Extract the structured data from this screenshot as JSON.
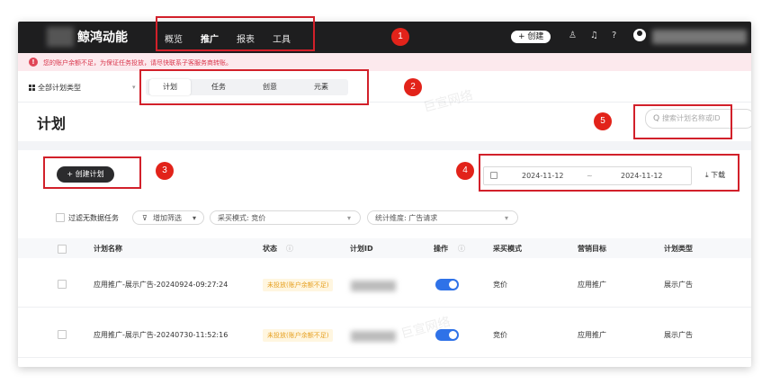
{
  "topbar": {
    "brand": "鲸鸿动能",
    "nav": [
      "概览",
      "推广",
      "报表",
      "工具"
    ],
    "active_nav": "推广",
    "create_label": "+ 创建",
    "icons": [
      "bulb-icon",
      "bell-icon",
      "help-icon",
      "user-icon"
    ]
  },
  "alert": {
    "icon": "!",
    "text": "您的账户余额不足，为保证任务投放，请尽快联系子客服务商转账。"
  },
  "plan_type_selector": "全部计划类型",
  "tabs": [
    "计划",
    "任务",
    "创意",
    "元素"
  ],
  "active_tab": "计划",
  "page_title": "计划",
  "search": {
    "placeholder": "搜索计划名称或ID",
    "icon": "Q"
  },
  "create_plan_label": "+ 创建计划",
  "date_range": {
    "start": "2024-11-12",
    "separator": "~",
    "end": "2024-11-12"
  },
  "download_label": "下载",
  "filters": {
    "filter_no_data": "过滤无数据任务",
    "add_filter": "增加筛选",
    "bidding": "采买模式: 竞价",
    "stat_dimension": "统计维度: 广告请求"
  },
  "table": {
    "headers": [
      "计划名称",
      "状态",
      "计划ID",
      "操作",
      "采买模式",
      "营销目标",
      "计划类型"
    ],
    "rows": [
      {
        "name": "应用推广-展示广告-20240924-09:27:24",
        "status": "未投放(账户余额不足)",
        "bidding": "竞价",
        "goal": "应用推广",
        "type": "展示广告",
        "enabled": true
      },
      {
        "name": "应用推广-展示广告-20240730-11:52:16",
        "status": "未投放(账户余额不足)",
        "bidding": "竞价",
        "goal": "应用推广",
        "type": "展示广告",
        "enabled": true
      }
    ]
  },
  "watermark": "巨宣网络",
  "annotations": [
    "1",
    "2",
    "3",
    "4",
    "5"
  ],
  "colors": {
    "topbar": "#1e1e1f",
    "highlight": "#d2202a",
    "toggle": "#2f72e8",
    "alert_bg": "#fce9ed"
  }
}
